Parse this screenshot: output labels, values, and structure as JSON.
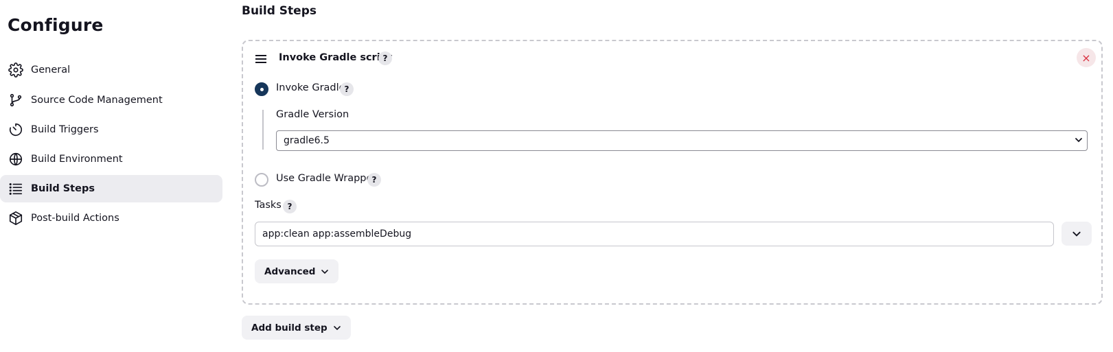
{
  "sidebar": {
    "title": "Configure",
    "items": [
      {
        "label": "General",
        "icon": "gear-icon"
      },
      {
        "label": "Source Code Management",
        "icon": "git-branch-icon"
      },
      {
        "label": "Build Triggers",
        "icon": "timer-icon"
      },
      {
        "label": "Build Environment",
        "icon": "globe-icon"
      },
      {
        "label": "Build Steps",
        "icon": "list-icon",
        "active": true
      },
      {
        "label": "Post-build Actions",
        "icon": "package-icon"
      }
    ]
  },
  "main": {
    "section_title": "Build Steps",
    "step": {
      "title": "Invoke Gradle script",
      "help": "?",
      "close": "×",
      "invoke_gradle": {
        "label": "Invoke Gradle",
        "help": "?",
        "selected": true
      },
      "gradle_version": {
        "label": "Gradle Version",
        "value": "gradle6.5"
      },
      "use_wrapper": {
        "label": "Use Gradle Wrapper",
        "help": "?",
        "selected": false
      },
      "tasks": {
        "label": "Tasks",
        "help": "?",
        "value": "app:clean app:assembleDebug"
      },
      "advanced_label": "Advanced"
    },
    "add_build_step_label": "Add build step"
  },
  "colors": {
    "accent": "#16365a",
    "active_nav_bg": "#ececf0",
    "close": "#d93040"
  }
}
